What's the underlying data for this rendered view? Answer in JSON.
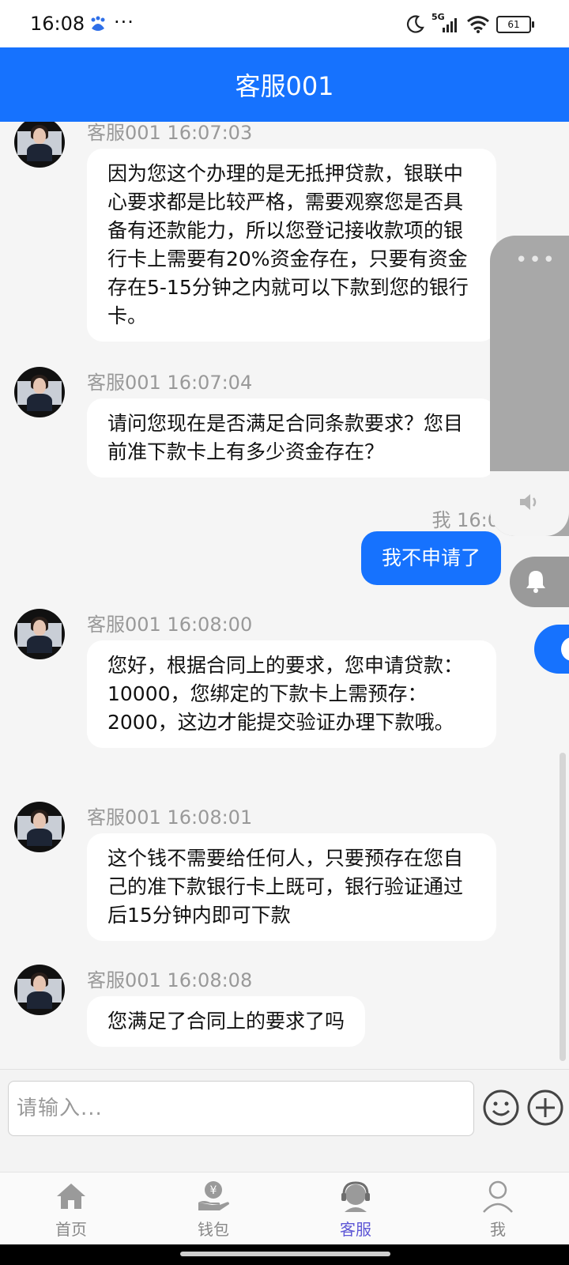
{
  "status_bar": {
    "time": "16:08",
    "dots": "···",
    "signal": "5G",
    "battery": "61"
  },
  "header": {
    "title": "客服001"
  },
  "messages": [
    {
      "side": "left",
      "meta": "客服001 16:07:03",
      "text": "因为您这个办理的是无抵押贷款，银联中心要求都是比较严格，需要观察您是否具备有还款能力，所以您登记接收款项的银行卡上需要有20%资金存在，只要有资金存在5-15分钟之内就可以下款到您的银行卡。"
    },
    {
      "side": "left",
      "meta": "客服001 16:07:04",
      "text": "请问您现在是否满足合同条款要求？您目前准下款卡上有多少资金存在？"
    },
    {
      "side": "right",
      "meta": "我 16:0",
      "text": "我不申请了"
    },
    {
      "side": "left",
      "meta": "客服001 16:08:00",
      "text": "您好，根据合同上的要求，您申请贷款：10000，您绑定的下款卡上需预存：2000，这边才能提交验证办理下款哦。"
    },
    {
      "side": "left",
      "meta": "客服001 16:08:01",
      "text": "这个钱不需要给任何人，只要预存在您自己的准下款银行卡上既可，银行验证通过后15分钟内即可下款"
    },
    {
      "side": "left",
      "meta": "客服001 16:08:08",
      "text": "您满足了合同上的要求了吗"
    }
  ],
  "input": {
    "placeholder": "请输入..."
  },
  "nav": [
    {
      "label": "首页",
      "icon": "home-icon"
    },
    {
      "label": "钱包",
      "icon": "wallet-icon"
    },
    {
      "label": "客服",
      "icon": "customer-service-icon",
      "active": true
    },
    {
      "label": "我",
      "icon": "user-icon"
    }
  ],
  "colors": {
    "brand": "#1672fe",
    "active_nav": "#5e57d6",
    "background": "#f5f5f5"
  }
}
